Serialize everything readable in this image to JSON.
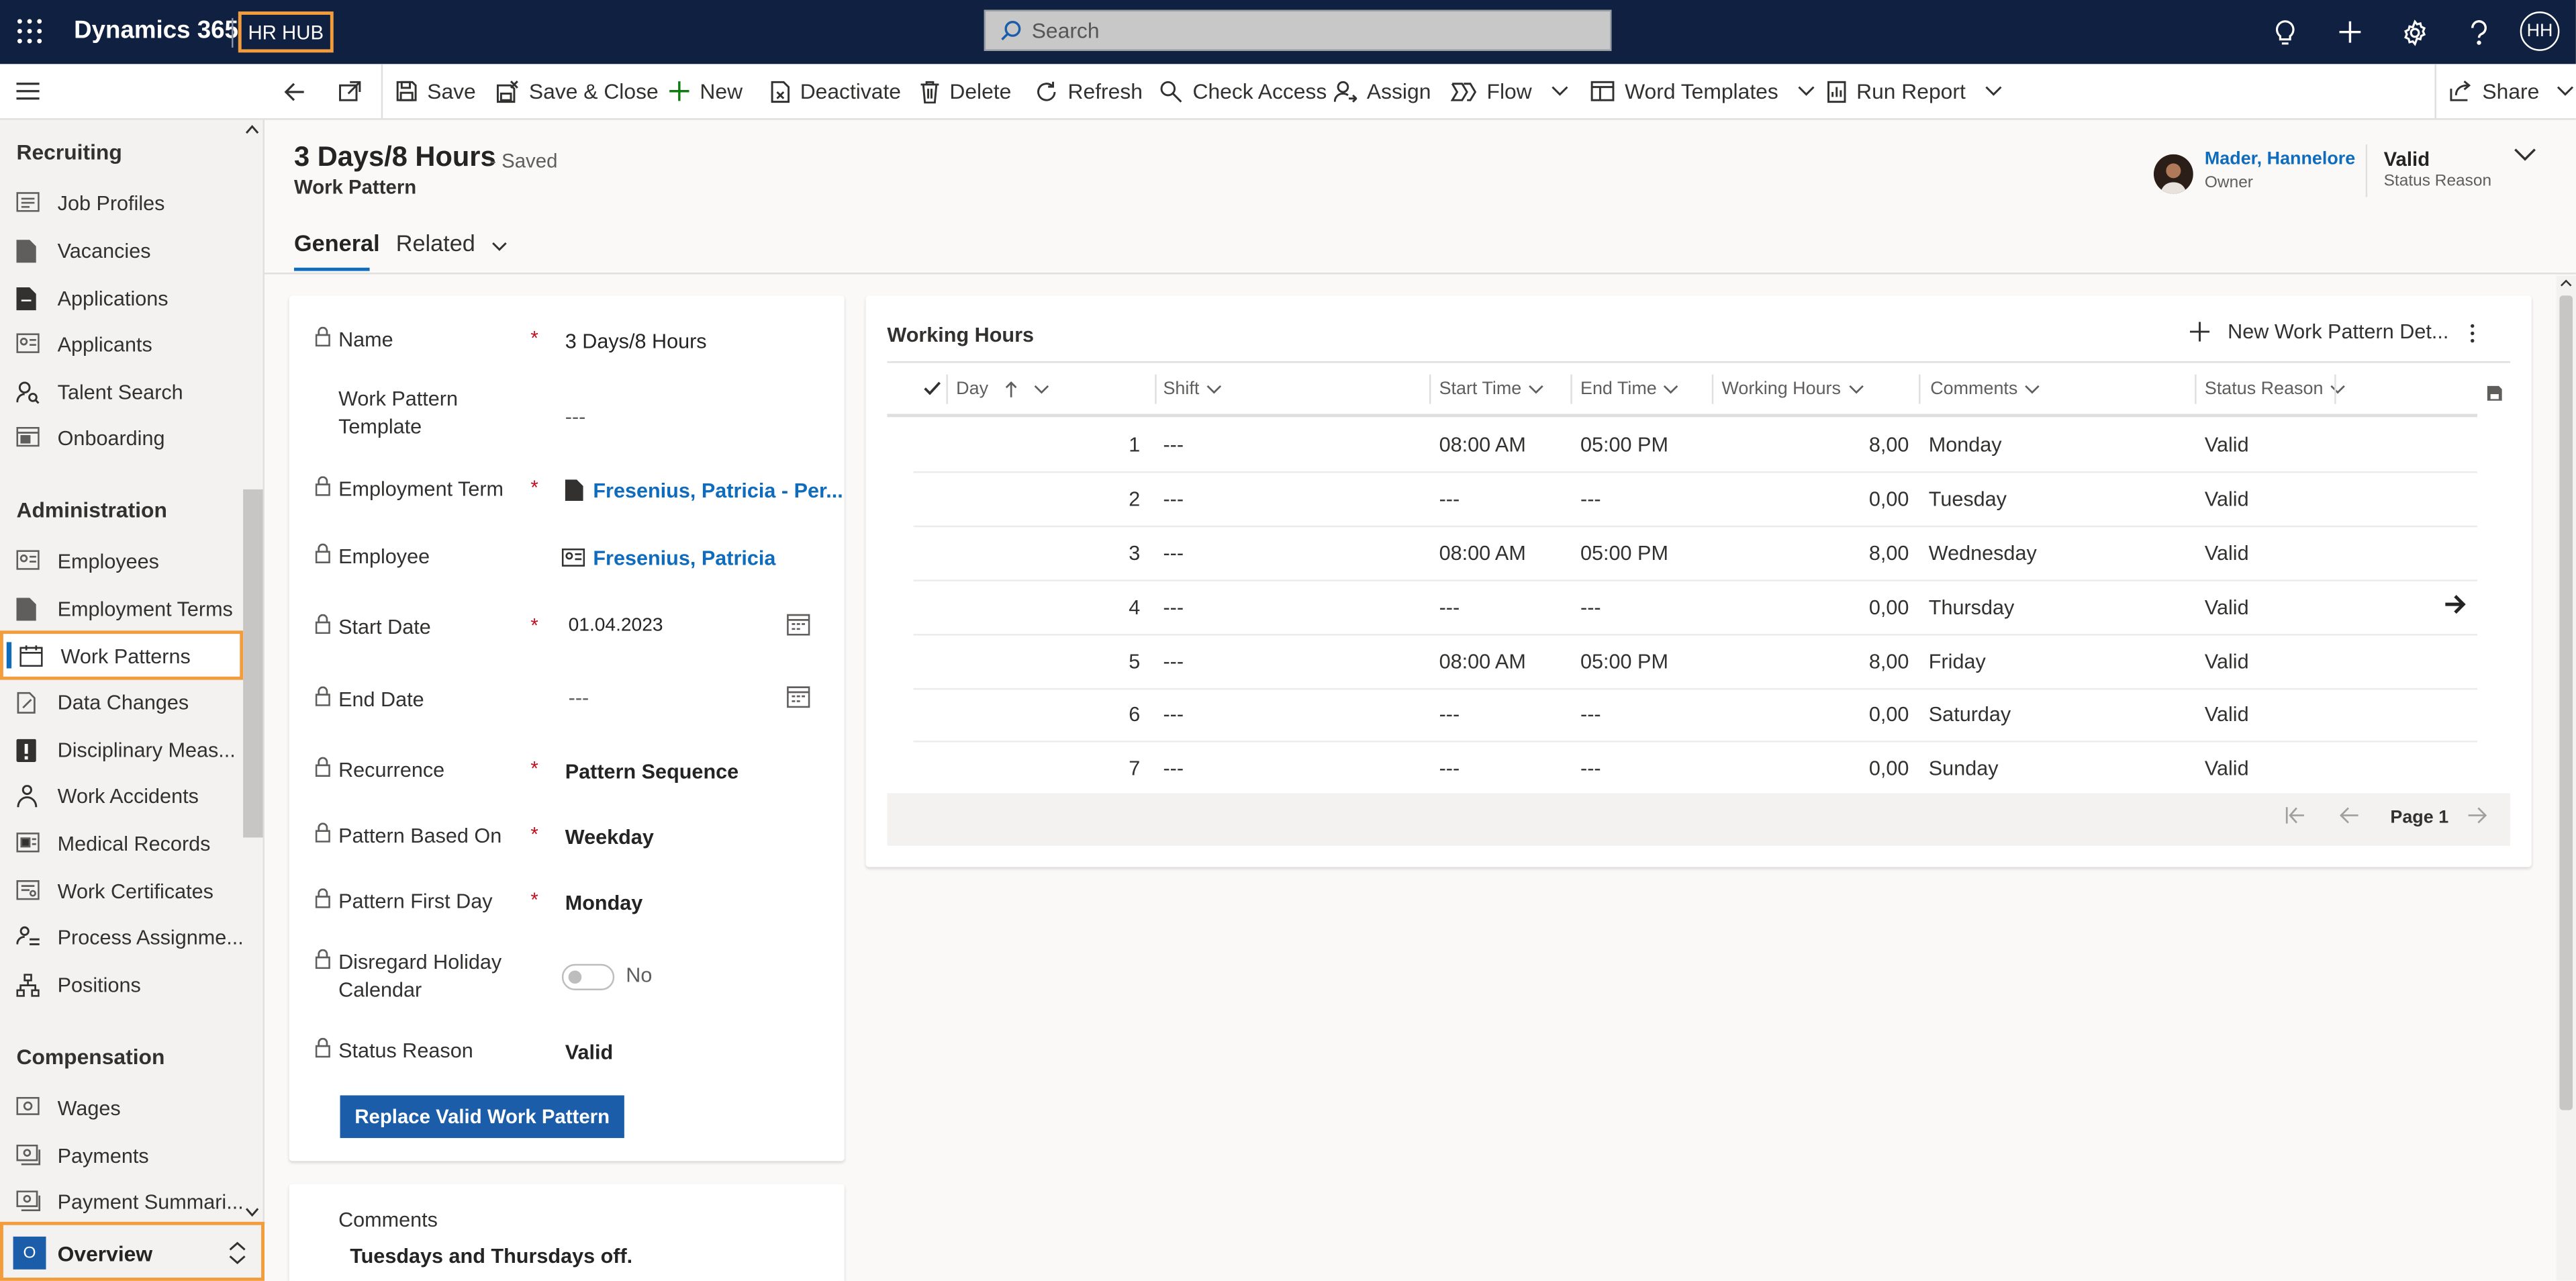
{
  "app": {
    "name": "Dynamics 365",
    "title": "HR HUB"
  },
  "search": {
    "placeholder": "Search"
  },
  "topbar": {
    "user_initials": "HH"
  },
  "commands": {
    "save": "Save",
    "save_close": "Save & Close",
    "new": "New",
    "deactivate": "Deactivate",
    "delete": "Delete",
    "refresh": "Refresh",
    "check_access": "Check Access",
    "assign": "Assign",
    "flow": "Flow",
    "word_templates": "Word Templates",
    "run_report": "Run Report",
    "share": "Share"
  },
  "sidebar": {
    "sections": [
      {
        "title": "Recruiting",
        "items": [
          {
            "label": "Job Profiles",
            "icon": "id-card-icon"
          },
          {
            "label": "Vacancies",
            "icon": "document-icon"
          },
          {
            "label": "Applications",
            "icon": "document-filled-icon"
          },
          {
            "label": "Applicants",
            "icon": "contact-card-icon"
          },
          {
            "label": "Talent Search",
            "icon": "person-search-icon"
          },
          {
            "label": "Onboarding",
            "icon": "board-icon"
          }
        ]
      },
      {
        "title": "Administration",
        "items": [
          {
            "label": "Employees",
            "icon": "contact-card-icon"
          },
          {
            "label": "Employment Terms",
            "icon": "document-icon"
          },
          {
            "label": "Work Patterns",
            "icon": "calendar-icon",
            "selected": true
          },
          {
            "label": "Data Changes",
            "icon": "document-edit-icon"
          },
          {
            "label": "Disciplinary Meas...",
            "icon": "alert-icon"
          },
          {
            "label": "Work Accidents",
            "icon": "person-walking-icon"
          },
          {
            "label": "Medical Records",
            "icon": "medical-icon"
          },
          {
            "label": "Work Certificates",
            "icon": "certificate-icon"
          },
          {
            "label": "Process Assignme...",
            "icon": "people-process-icon"
          },
          {
            "label": "Positions",
            "icon": "org-chart-icon"
          }
        ]
      },
      {
        "title": "Compensation",
        "items": [
          {
            "label": "Wages",
            "icon": "money-icon"
          },
          {
            "label": "Payments",
            "icon": "payment-icon"
          },
          {
            "label": "Payment Summari...",
            "icon": "payment-icon"
          }
        ]
      }
    ],
    "area": {
      "badge": "O",
      "label": "Overview"
    }
  },
  "record": {
    "title": "3 Days/8 Hours",
    "saved": "- Saved",
    "entity": "Work Pattern",
    "owner": {
      "name": "Mader, Hannelore",
      "caption": "Owner"
    },
    "status": {
      "value": "Valid",
      "caption": "Status Reason"
    }
  },
  "tabs": {
    "general": "General",
    "related": "Related"
  },
  "form": {
    "name": {
      "label": "Name",
      "value": "3 Days/8 Hours"
    },
    "template": {
      "label_1": "Work Pattern",
      "label_2": "Template",
      "value": "---"
    },
    "employment_term": {
      "label": "Employment Term",
      "value": "Fresenius, Patricia - Per..."
    },
    "employee": {
      "label": "Employee",
      "value": "Fresenius, Patricia"
    },
    "start_date": {
      "label": "Start Date",
      "value": "01.04.2023"
    },
    "end_date": {
      "label": "End Date",
      "value": "---"
    },
    "recurrence": {
      "label": "Recurrence",
      "value": "Pattern Sequence"
    },
    "based_on": {
      "label": "Pattern Based On",
      "value": "Weekday"
    },
    "first_day": {
      "label": "Pattern First Day",
      "value": "Monday"
    },
    "disregard": {
      "label_1": "Disregard Holiday",
      "label_2": "Calendar",
      "value": "No"
    },
    "status_reason": {
      "label": "Status Reason",
      "value": "Valid"
    },
    "replace_button": "Replace Valid Work Pattern",
    "required_mark": "*"
  },
  "comments": {
    "label": "Comments",
    "value": "Tuesdays and Thursdays off."
  },
  "grid": {
    "title": "Working Hours",
    "new_label": "New Work Pattern Det...",
    "headers": {
      "day": "Day",
      "shift": "Shift",
      "start": "Start Time",
      "end": "End Time",
      "hours": "Working Hours",
      "comments": "Comments",
      "status": "Status Reason"
    },
    "rows": [
      {
        "day": "1",
        "shift": "---",
        "start": "08:00 AM",
        "end": "05:00 PM",
        "hours": "8,00",
        "comments": "Monday",
        "status": "Valid"
      },
      {
        "day": "2",
        "shift": "---",
        "start": "---",
        "end": "---",
        "hours": "0,00",
        "comments": "Tuesday",
        "status": "Valid"
      },
      {
        "day": "3",
        "shift": "---",
        "start": "08:00 AM",
        "end": "05:00 PM",
        "hours": "8,00",
        "comments": "Wednesday",
        "status": "Valid"
      },
      {
        "day": "4",
        "shift": "---",
        "start": "---",
        "end": "---",
        "hours": "0,00",
        "comments": "Thursday",
        "status": "Valid"
      },
      {
        "day": "5",
        "shift": "---",
        "start": "08:00 AM",
        "end": "05:00 PM",
        "hours": "8,00",
        "comments": "Friday",
        "status": "Valid"
      },
      {
        "day": "6",
        "shift": "---",
        "start": "---",
        "end": "---",
        "hours": "0,00",
        "comments": "Saturday",
        "status": "Valid"
      },
      {
        "day": "7",
        "shift": "---",
        "start": "---",
        "end": "---",
        "hours": "0,00",
        "comments": "Sunday",
        "status": "Valid"
      }
    ],
    "page_label": "Page 1"
  },
  "colors": {
    "nav_bg": "#0f2040",
    "accent": "#0f6cbd",
    "highlight": "#f39c3c",
    "button": "#1b5da8"
  }
}
